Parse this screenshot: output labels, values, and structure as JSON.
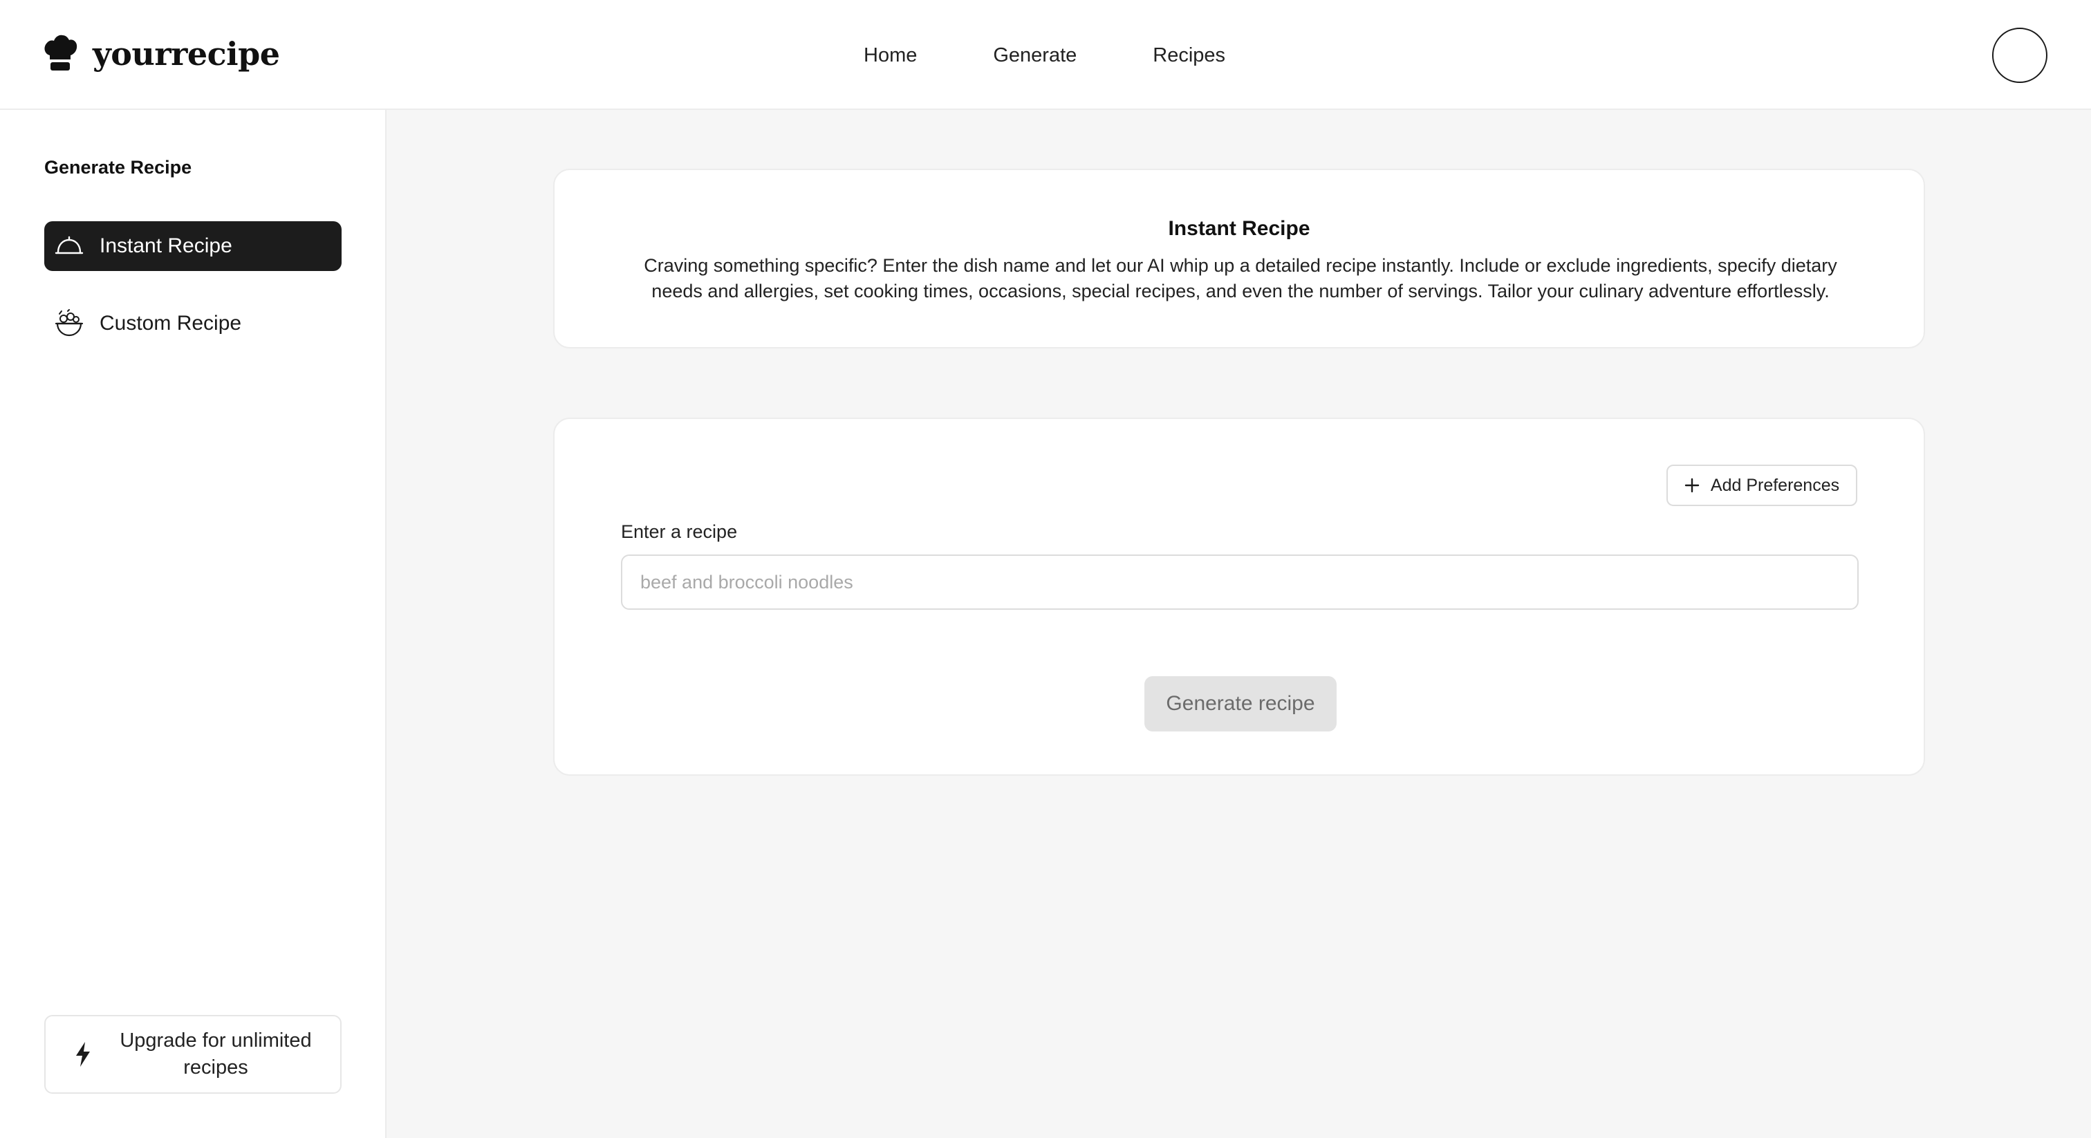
{
  "header": {
    "brand": "yourrecipe",
    "nav": [
      "Home",
      "Generate",
      "Recipes"
    ]
  },
  "sidebar": {
    "title": "Generate Recipe",
    "items": [
      {
        "label": "Instant Recipe",
        "icon": "cloche-icon",
        "active": true
      },
      {
        "label": "Custom Recipe",
        "icon": "salad-bowl-icon",
        "active": false
      }
    ],
    "upgrade": {
      "label": "Upgrade for unlimited recipes",
      "icon": "lightning-icon"
    }
  },
  "intro": {
    "title": "Instant Recipe",
    "description": "Craving something specific? Enter the dish name and let our AI whip up a detailed recipe instantly. Include or exclude ingredients, specify dietary needs and allergies, set cooking times, occasions, special recipes, and even the number of servings. Tailor your culinary adventure effortlessly."
  },
  "form": {
    "add_preferences_label": "Add Preferences",
    "recipe_label": "Enter a recipe",
    "recipe_placeholder": "beef and broccoli noodles",
    "recipe_value": "",
    "generate_label": "Generate recipe"
  },
  "colors": {
    "accent_dark": "#1c1c1c",
    "background": "#f6f6f6",
    "disabled_button": "#e3e3e3"
  }
}
